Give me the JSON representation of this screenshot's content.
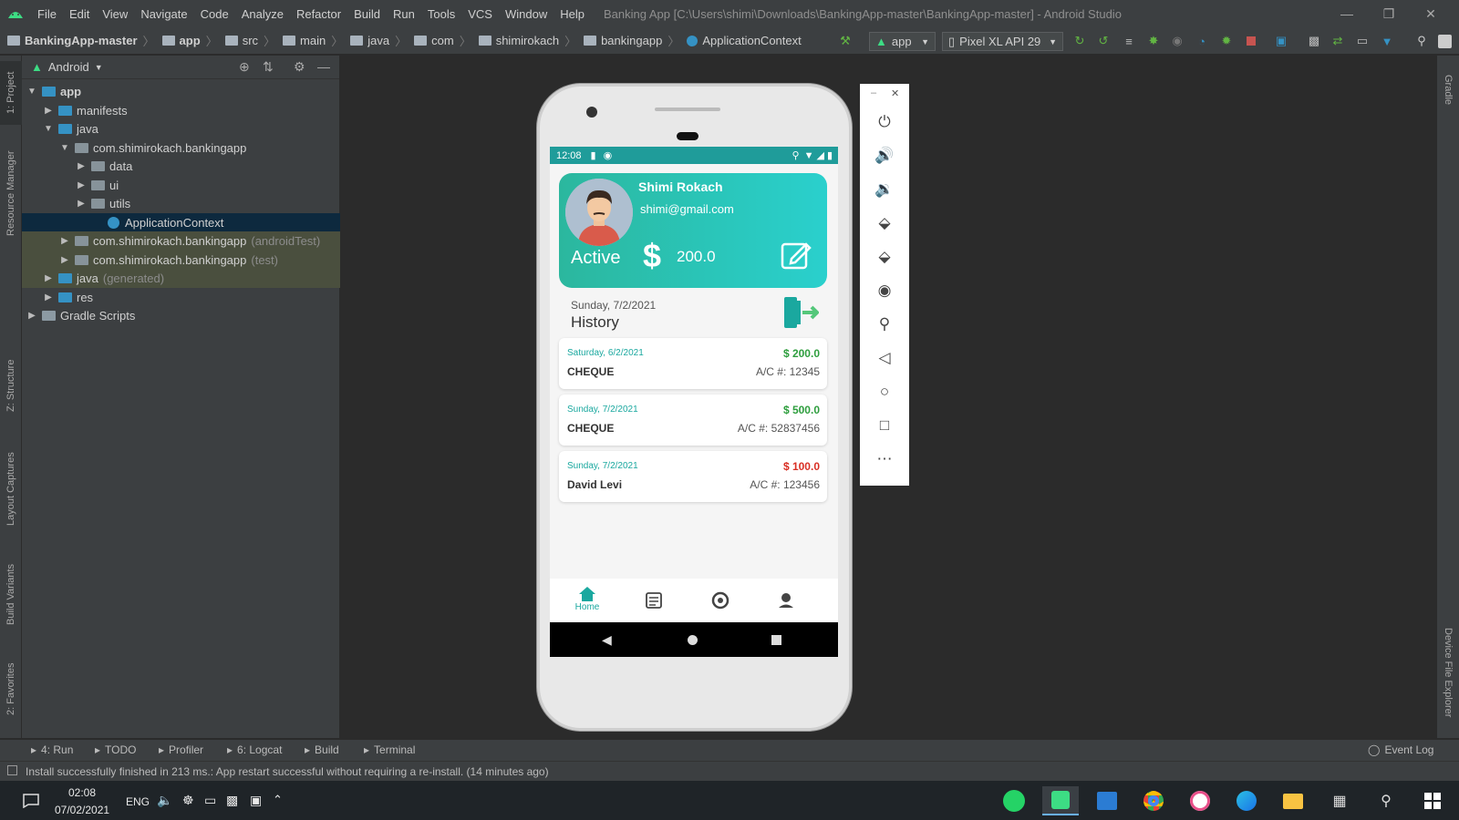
{
  "menubar": {
    "items": [
      "File",
      "Edit",
      "View",
      "Navigate",
      "Code",
      "Analyze",
      "Refactor",
      "Build",
      "Run",
      "Tools",
      "VCS",
      "Window",
      "Help"
    ],
    "window_title": "Banking App [C:\\Users\\shimi\\Downloads\\BankingApp-master\\BankingApp-master] - Android Studio"
  },
  "breadcrumb": [
    "BankingApp-master",
    "app",
    "src",
    "main",
    "java",
    "com",
    "shimirokach",
    "bankingapp",
    "ApplicationContext"
  ],
  "toolbar": {
    "run_config": "app",
    "device": "Pixel XL API 29"
  },
  "project_panel": {
    "view_mode": "Android",
    "tree": [
      {
        "label": "app",
        "extra": "",
        "depth": 0,
        "expanded": true,
        "kind": "module"
      },
      {
        "label": "manifests",
        "extra": "",
        "depth": 1,
        "expanded": false,
        "kind": "folder"
      },
      {
        "label": "java",
        "extra": "",
        "depth": 1,
        "expanded": true,
        "kind": "folder"
      },
      {
        "label": "com.shimirokach.bankingapp",
        "extra": "",
        "depth": 2,
        "expanded": true,
        "kind": "package"
      },
      {
        "label": "data",
        "extra": "",
        "depth": 3,
        "expanded": false,
        "kind": "package"
      },
      {
        "label": "ui",
        "extra": "",
        "depth": 3,
        "expanded": false,
        "kind": "package"
      },
      {
        "label": "utils",
        "extra": "",
        "depth": 3,
        "expanded": false,
        "kind": "package"
      },
      {
        "label": "ApplicationContext",
        "extra": "",
        "depth": 4,
        "expanded": null,
        "kind": "class"
      },
      {
        "label": "com.shimirokach.bankingapp",
        "extra": "(androidTest)",
        "depth": 2,
        "expanded": false,
        "kind": "package"
      },
      {
        "label": "com.shimirokach.bankingapp",
        "extra": "(test)",
        "depth": 2,
        "expanded": false,
        "kind": "package"
      },
      {
        "label": "java",
        "extra": "(generated)",
        "depth": 1,
        "expanded": false,
        "kind": "folder"
      },
      {
        "label": "res",
        "extra": "",
        "depth": 1,
        "expanded": false,
        "kind": "folder"
      },
      {
        "label": "Gradle Scripts",
        "extra": "",
        "depth": 0,
        "expanded": false,
        "kind": "gradle"
      }
    ]
  },
  "left_stripe": [
    "1: Project",
    "Resource Manager",
    "Z: Structure",
    "Layout Captures",
    "Build Variants",
    "2: Favorites"
  ],
  "right_stripe": [
    "Gradle",
    "Device File Explorer"
  ],
  "phone": {
    "status_time": "12:08",
    "user_name": "Shimi Rokach",
    "user_email": "shimi@gmail.com",
    "account_status": "Active",
    "currency_symbol": "$",
    "balance": "200.0",
    "current_date": "Sunday, 7/2/2021",
    "history_title": "History",
    "transactions": [
      {
        "date": "Saturday, 6/2/2021",
        "name": "CHEQUE",
        "amount": "$ 200.0",
        "account": "A/C #: 12345",
        "color": "#2e9e3e"
      },
      {
        "date": "Sunday, 7/2/2021",
        "name": "CHEQUE",
        "amount": "$ 500.0",
        "account": "A/C #: 52837456",
        "color": "#2e9e3e"
      },
      {
        "date": "Sunday, 7/2/2021",
        "name": "David Levi",
        "amount": "$ 100.0",
        "account": "A/C #: 123456",
        "color": "#d93025"
      }
    ],
    "bottom_nav": {
      "home_label": "Home"
    }
  },
  "bottom_tools": [
    {
      "label": "4: Run",
      "icon": "run-icon"
    },
    {
      "label": "TODO",
      "icon": "list-icon"
    },
    {
      "label": "Profiler",
      "icon": "profiler-icon"
    },
    {
      "label": "6: Logcat",
      "icon": "logcat-icon"
    },
    {
      "label": "Build",
      "icon": "hammer-icon"
    },
    {
      "label": "Terminal",
      "icon": "terminal-icon"
    }
  ],
  "event_log_label": "Event Log",
  "status_message": "Install successfully finished in 213 ms.: App restart successful without requiring a re-install. (14 minutes ago)",
  "taskbar": {
    "time": "02:08",
    "date": "07/02/2021",
    "language": "ENG"
  }
}
